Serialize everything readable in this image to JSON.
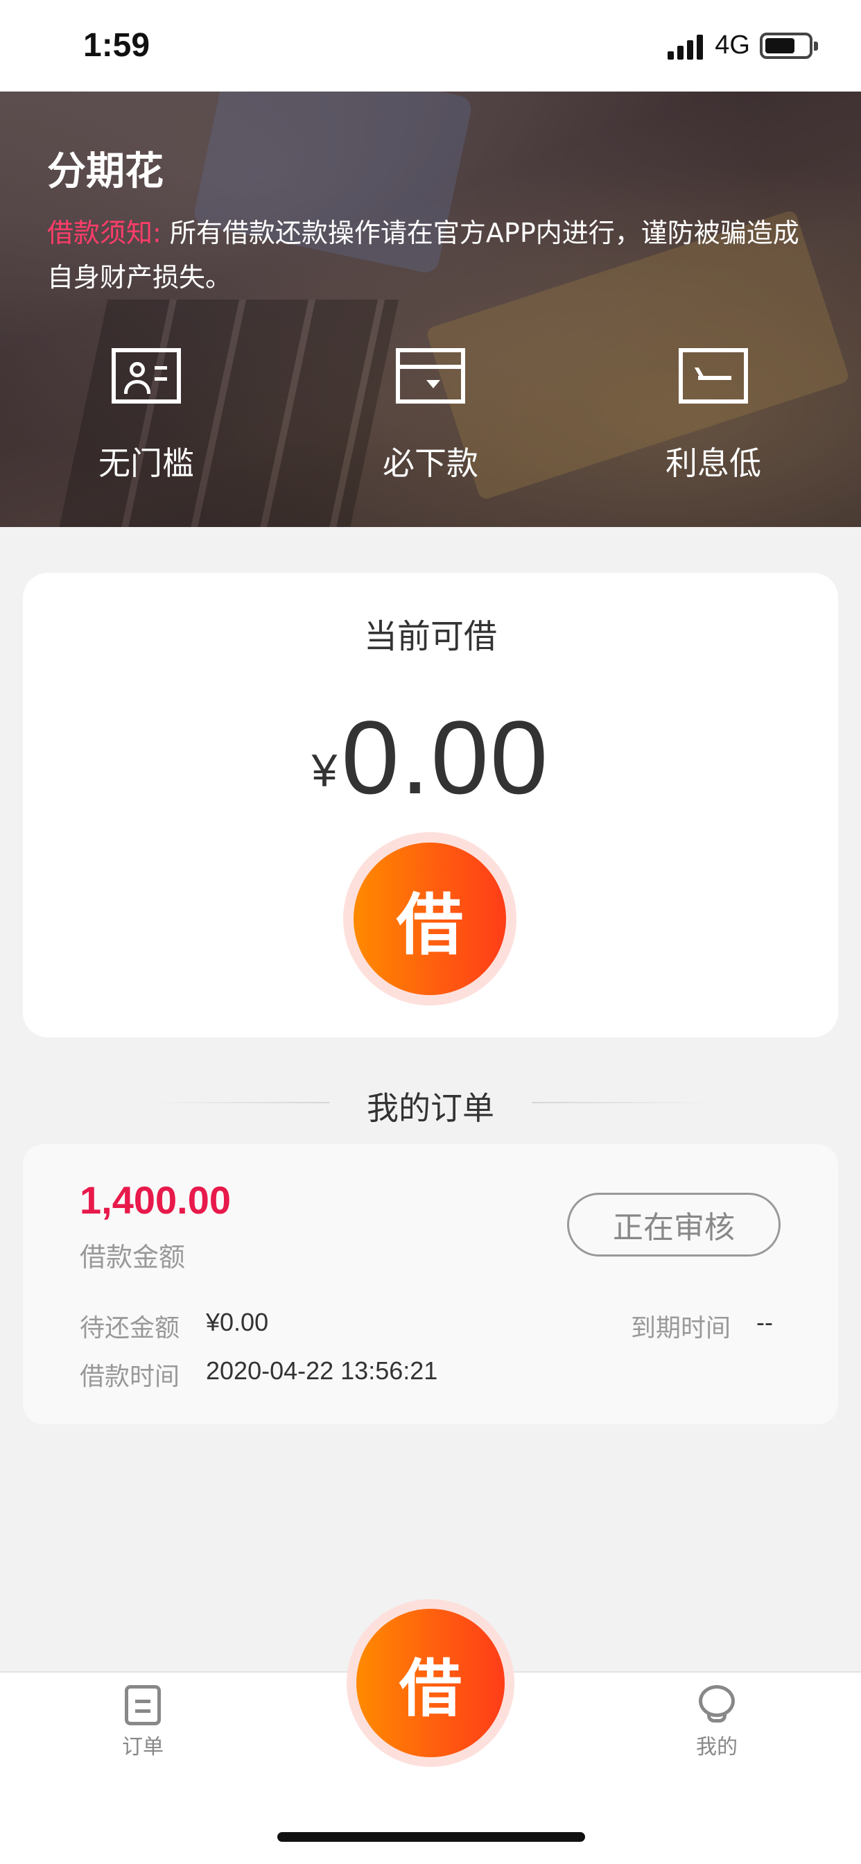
{
  "status_bar": {
    "time": "1:59",
    "network": "4G"
  },
  "banner": {
    "app_title": "分期花",
    "notice_label": "借款须知:",
    "notice_text": "所有借款还款操作请在官方APP内进行，谨防被骗造成自身财产损失。",
    "features": [
      {
        "icon": "id-card-icon",
        "label": "无门槛"
      },
      {
        "icon": "wallet-icon",
        "label": "必下款"
      },
      {
        "icon": "return-icon",
        "label": "利息低"
      }
    ]
  },
  "borrow": {
    "title": "当前可借",
    "currency": "¥",
    "amount": "0.00",
    "button_label": "借"
  },
  "orders": {
    "title": "我的订单",
    "items": [
      {
        "amount": "1,400.00",
        "amount_label": "借款金额",
        "status": "正在审核",
        "pending_label": "待还金额",
        "pending_value": "¥0.00",
        "due_label": "到期时间",
        "due_value": "--",
        "time_label": "借款时间",
        "time_value": "2020-04-22 13:56:21"
      }
    ]
  },
  "tab_bar": {
    "orders_label": "订单",
    "center_label": "借",
    "mine_label": "我的"
  },
  "colors": {
    "accent": "#ff5a10",
    "amount_red": "#e8194b",
    "notice_pink": "#ff3d6a"
  }
}
